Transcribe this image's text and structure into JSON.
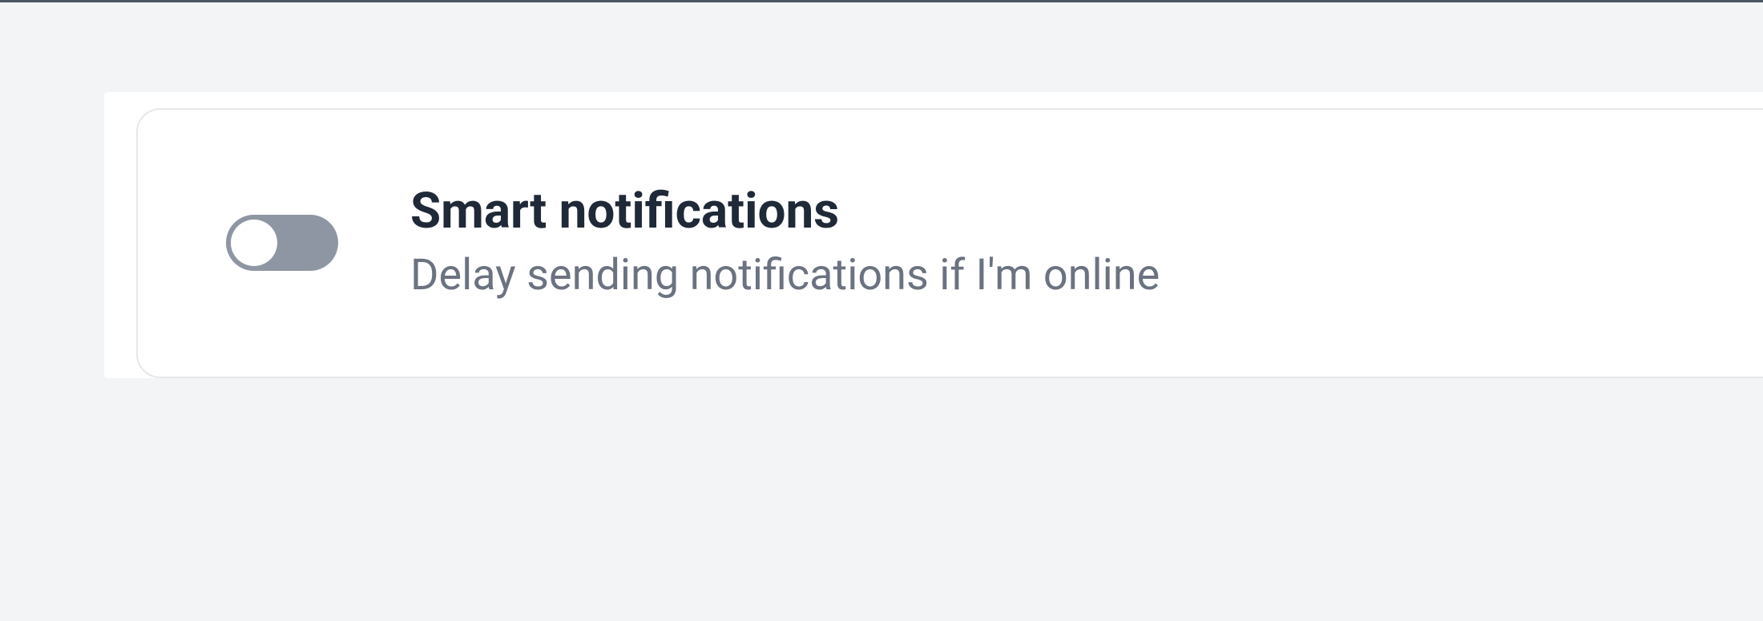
{
  "settings": {
    "smartNotifications": {
      "title": "Smart notifications",
      "description": "Delay sending notifications if I'm online",
      "enabled": false
    }
  }
}
